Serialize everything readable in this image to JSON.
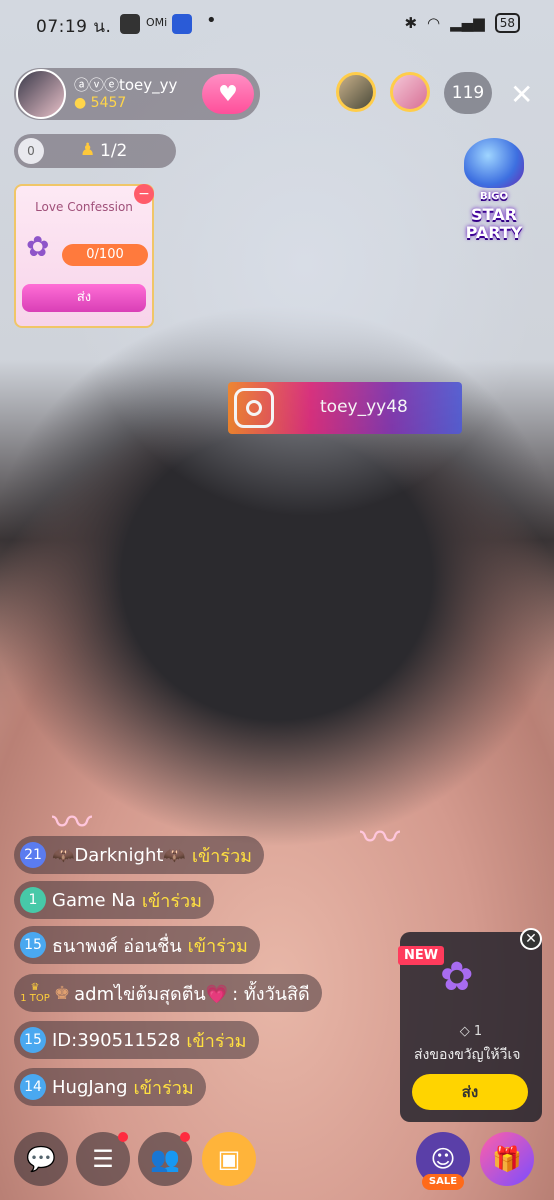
{
  "status_bar": {
    "time": "07:19 น.",
    "icon_label": "OMi",
    "battery": "58"
  },
  "host": {
    "name": "ⓐⓥⓔtoey_yy",
    "coins": "5457"
  },
  "viewer_count": "119",
  "rank": {
    "star_label": "0",
    "level": "1/2"
  },
  "love_confession": {
    "title": "Love Confession",
    "progress": "0/100",
    "send_label": "ส่ง"
  },
  "star_party": {
    "brand": "BIGO",
    "line1": "STAR",
    "line2": "PARTY"
  },
  "instagram": {
    "handle": "toey_yy48"
  },
  "chat": [
    {
      "level": "21",
      "level_color": "#5b7cf0",
      "user": "🦇Darknight🦇",
      "action": "เข้าร่วม"
    },
    {
      "level": "1",
      "level_color": "#47c9a8",
      "user": "Game Na",
      "action": "เข้าร่วม"
    },
    {
      "level": "15",
      "level_color": "#4aa8f0",
      "user": "ธนาพงศ์ อ่อนชื่น",
      "action": "เข้าร่วม"
    },
    {
      "badge": "TOP",
      "badge_rank": "1",
      "user": "admไข่ต้มสุดตีน💗",
      "message": ": ทั้งวันสิดี"
    },
    {
      "level": "15",
      "level_color": "#4aa8f0",
      "user": "ID:390511528",
      "action": "เข้าร่วม"
    },
    {
      "level": "14",
      "level_color": "#4aa8f0",
      "user": "HugJang",
      "action": "เข้าร่วม"
    }
  ],
  "gift_card": {
    "badge": "NEW",
    "price": "1",
    "label": "ส่งของขวัญให้วีเจ",
    "send_label": "ส่ง"
  },
  "bottom_bar": {
    "sale_label": "SALE"
  }
}
